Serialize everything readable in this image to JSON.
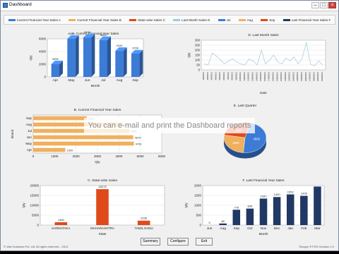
{
  "window": {
    "title": "Dashboard",
    "minimize": "–",
    "maximize": "□",
    "close": "×"
  },
  "legend": [
    {
      "label": "Current Financial Year Sales A",
      "color": "#3c7bd6"
    },
    {
      "label": "Current Financial Year Sales B",
      "color": "#f0b060"
    },
    {
      "label": "State-wise Sales C",
      "color": "#e04a1a"
    },
    {
      "label": "Last Month Sales D",
      "color": "#a0c8dc"
    },
    {
      "label": "Jul",
      "color": "#3c7bd6"
    },
    {
      "label": "Aug",
      "color": "#f0b060"
    },
    {
      "label": "Sep",
      "color": "#e04a1a"
    },
    {
      "label": "Last Financial Year Sales F",
      "color": "#1f3864"
    }
  ],
  "overlay_text": "You can e-mail and print the Dashboard reports",
  "buttons": {
    "summary": "Summary",
    "configure": "Configure",
    "exit": "Exit"
  },
  "status": {
    "left": "© Vats Solutions Pvt. Ltd. All rights reserved – 2013",
    "right": "Shoppe ® POS Solution 2.0"
  },
  "chart_data": [
    {
      "type": "bar",
      "title": "A. Current Financial Year Sales",
      "xlabel": "Month",
      "ylabel": "Qty",
      "categories": [
        "Apr",
        "May",
        "Jun",
        "Jul",
        "Aug",
        "Sep"
      ],
      "values": [
        2000,
        6000,
        6200,
        5800,
        4100,
        3700
      ],
      "data_labels": [
        "2000",
        "6000",
        "6200",
        "5800",
        "4100",
        "3700"
      ],
      "ylim": [
        0,
        6000
      ],
      "yticks": [
        0,
        2000,
        4000,
        6000
      ],
      "color": "#3c7bd6"
    },
    {
      "type": "line",
      "title": "D. Last Month Sales",
      "xlabel": "Date",
      "ylabel": "Qty",
      "x": [
        "1/06/2013",
        "2/06/2013",
        "3/06/2013",
        "4/06/2013",
        "5/06/2013",
        "6/06/2013",
        "7/06/2013",
        "8/06/2013",
        "9/06/2013",
        "10/06/2013",
        "11/06/2013",
        "12/06/2013",
        "13/06/2013",
        "14/06/2013",
        "15/06/2013",
        "16/06/2013",
        "17/06/2013",
        "18/06/2013",
        "19/06/2013",
        "20/06/2013",
        "21/06/2013",
        "22/06/2013",
        "23/06/2013",
        "24/06/2013",
        "25/06/2013",
        "26/06/2013",
        "27/06/2013",
        "28/06/2013",
        "29/06/2013",
        "30/06/2013"
      ],
      "values": [
        60,
        50,
        170,
        140,
        100,
        60,
        90,
        110,
        80,
        60,
        50,
        110,
        90,
        50,
        200,
        60,
        100,
        150,
        80,
        60,
        120,
        90,
        130,
        60,
        120,
        280,
        60,
        40,
        90,
        50
      ],
      "ylim": [
        0,
        300
      ],
      "yticks": [
        0,
        50,
        100,
        150,
        200,
        250,
        300
      ],
      "color": "#a8cfe0"
    },
    {
      "type": "bar",
      "orientation": "horizontal",
      "title": "B. Current Financial Year Sales",
      "xlabel": "Qty",
      "ylabel": "Brand",
      "categories": [
        "Sep",
        "Aug",
        "Jul",
        "Jun",
        "May",
        "Apr"
      ],
      "values": [
        2500,
        4200,
        4500,
        4670,
        4700,
        1500
      ],
      "data_labels": [
        "2500",
        "4200",
        "4500",
        "4670",
        "4700",
        "1500"
      ],
      "xlim": [
        0,
        6000
      ],
      "xticks": [
        0,
        1000,
        2000,
        3000,
        4000,
        5000,
        6000
      ],
      "color": "#f0b060"
    },
    {
      "type": "pie",
      "title": "E. Last Quarter",
      "categories": [
        "Jul",
        "Aug",
        "Sep"
      ],
      "values": [
        4505,
        2500,
        2503
      ],
      "data_labels": [
        "4505",
        "2500",
        "2503"
      ],
      "colors": [
        "#3c7bd6",
        "#f0b060",
        "#e04a1a"
      ]
    },
    {
      "type": "bar",
      "title": "C. State-wise Sales",
      "xlabel": "State",
      "ylabel": "Qty",
      "categories": [
        "KARNATAKA",
        "MAHARASHTRA",
        "TAMIL NADU"
      ],
      "values": [
        1450,
        18173,
        2235
      ],
      "data_labels": [
        "1450",
        "18173",
        "2235"
      ],
      "ylim": [
        0,
        20000
      ],
      "yticks": [
        0,
        5000,
        10000,
        15000,
        20000
      ],
      "color": "#e04a1a"
    },
    {
      "type": "bar",
      "title": "F. Last Financial Year Sales",
      "xlabel": "Month",
      "ylabel": "Qty",
      "categories": [
        "Jun",
        "Aug",
        "Sep",
        "Oct",
        "Nov",
        "Dec",
        "Jan",
        "Feb",
        "Mar"
      ],
      "values": [
        0,
        80,
        776,
        834,
        1341,
        1420,
        1552,
        1478,
        1950
      ],
      "data_labels": [
        "0",
        "80",
        "776",
        "834",
        "1341",
        "1420",
        "1552",
        "1478",
        ""
      ],
      "ylim": [
        0,
        2000
      ],
      "yticks": [
        0,
        500,
        1000,
        1500,
        2000
      ],
      "color": "#1f3864"
    }
  ]
}
